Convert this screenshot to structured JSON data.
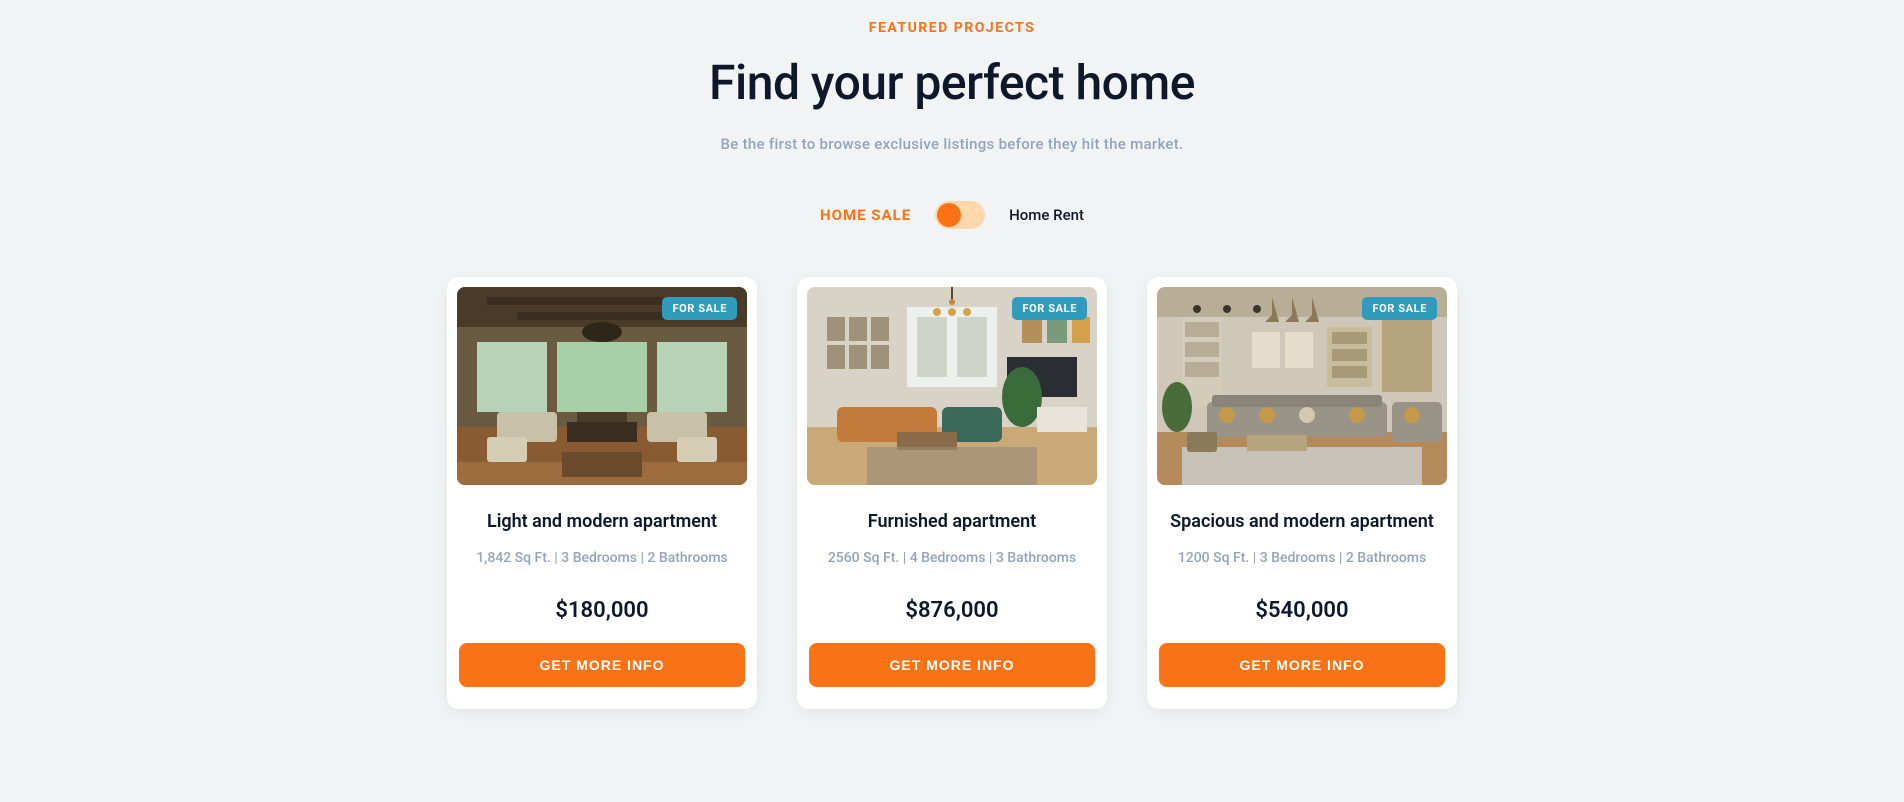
{
  "header": {
    "eyebrow": "FEATURED PROJECTS",
    "title": "Find your perfect home",
    "subtitle": "Be the first to browse exclusive listings before they hit the market."
  },
  "toggle": {
    "left_label": "HOME SALE",
    "right_label": "Home Rent",
    "active": "left"
  },
  "badge_text": "FOR SALE",
  "cta_text": "GET MORE INFO",
  "listings": [
    {
      "title": "Light and modern apartment",
      "specs": "1,842 Sq Ft. | 3 Bedrooms | 2 Bathrooms",
      "price": "$180,000"
    },
    {
      "title": "Furnished apartment",
      "specs": "2560 Sq Ft. | 4 Bedrooms | 3 Bathrooms",
      "price": "$876,000"
    },
    {
      "title": "Spacious and modern apartment",
      "specs": "1200 Sq Ft. | 3 Bedrooms | 2 Bathrooms",
      "price": "$540,000"
    }
  ],
  "colors": {
    "accent": "#f97316",
    "badge": "#2f9cbb",
    "text_dark": "#0f172a",
    "text_muted": "#94a3b8"
  }
}
